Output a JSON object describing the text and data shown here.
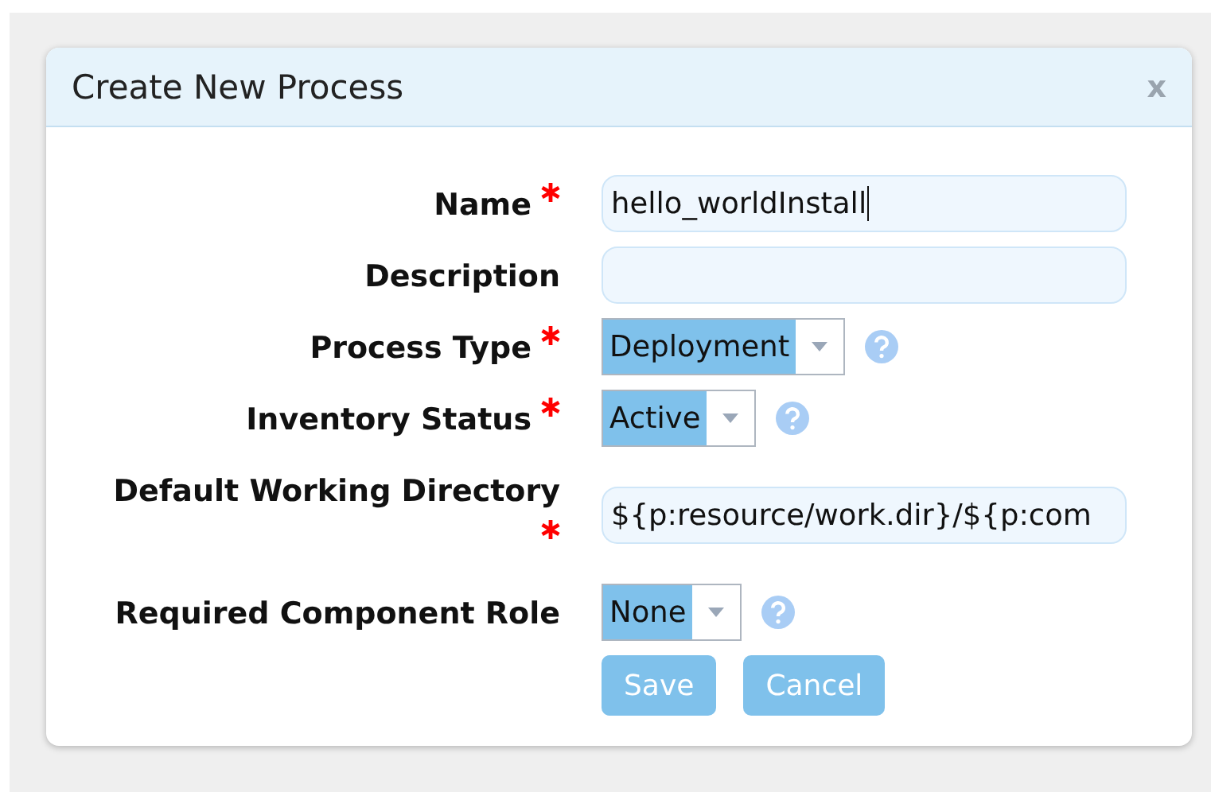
{
  "dialog": {
    "title": "Create New Process",
    "close": "x"
  },
  "fields": [
    {
      "kind": "text",
      "label": "Name",
      "required": true,
      "value": "hello_worldInstall",
      "focused": true,
      "help": false
    },
    {
      "kind": "text",
      "label": "Description",
      "required": false,
      "focused": false,
      "help": false
    },
    {
      "kind": "select",
      "label": "Process Type",
      "required": true,
      "value": "Deployment",
      "help": true
    },
    {
      "kind": "select",
      "label": "Inventory Status",
      "required": true,
      "value": "Active",
      "help": true
    },
    {
      "kind": "text",
      "label": "Default Working Directory",
      "required": true,
      "value": "${p:resource/work.dir}/${p:com",
      "focused": false,
      "help": false
    },
    {
      "kind": "select",
      "label": "Required Component Role",
      "required": false,
      "value": "None",
      "help": true
    }
  ],
  "buttons": [
    "Save",
    "Cancel"
  ]
}
